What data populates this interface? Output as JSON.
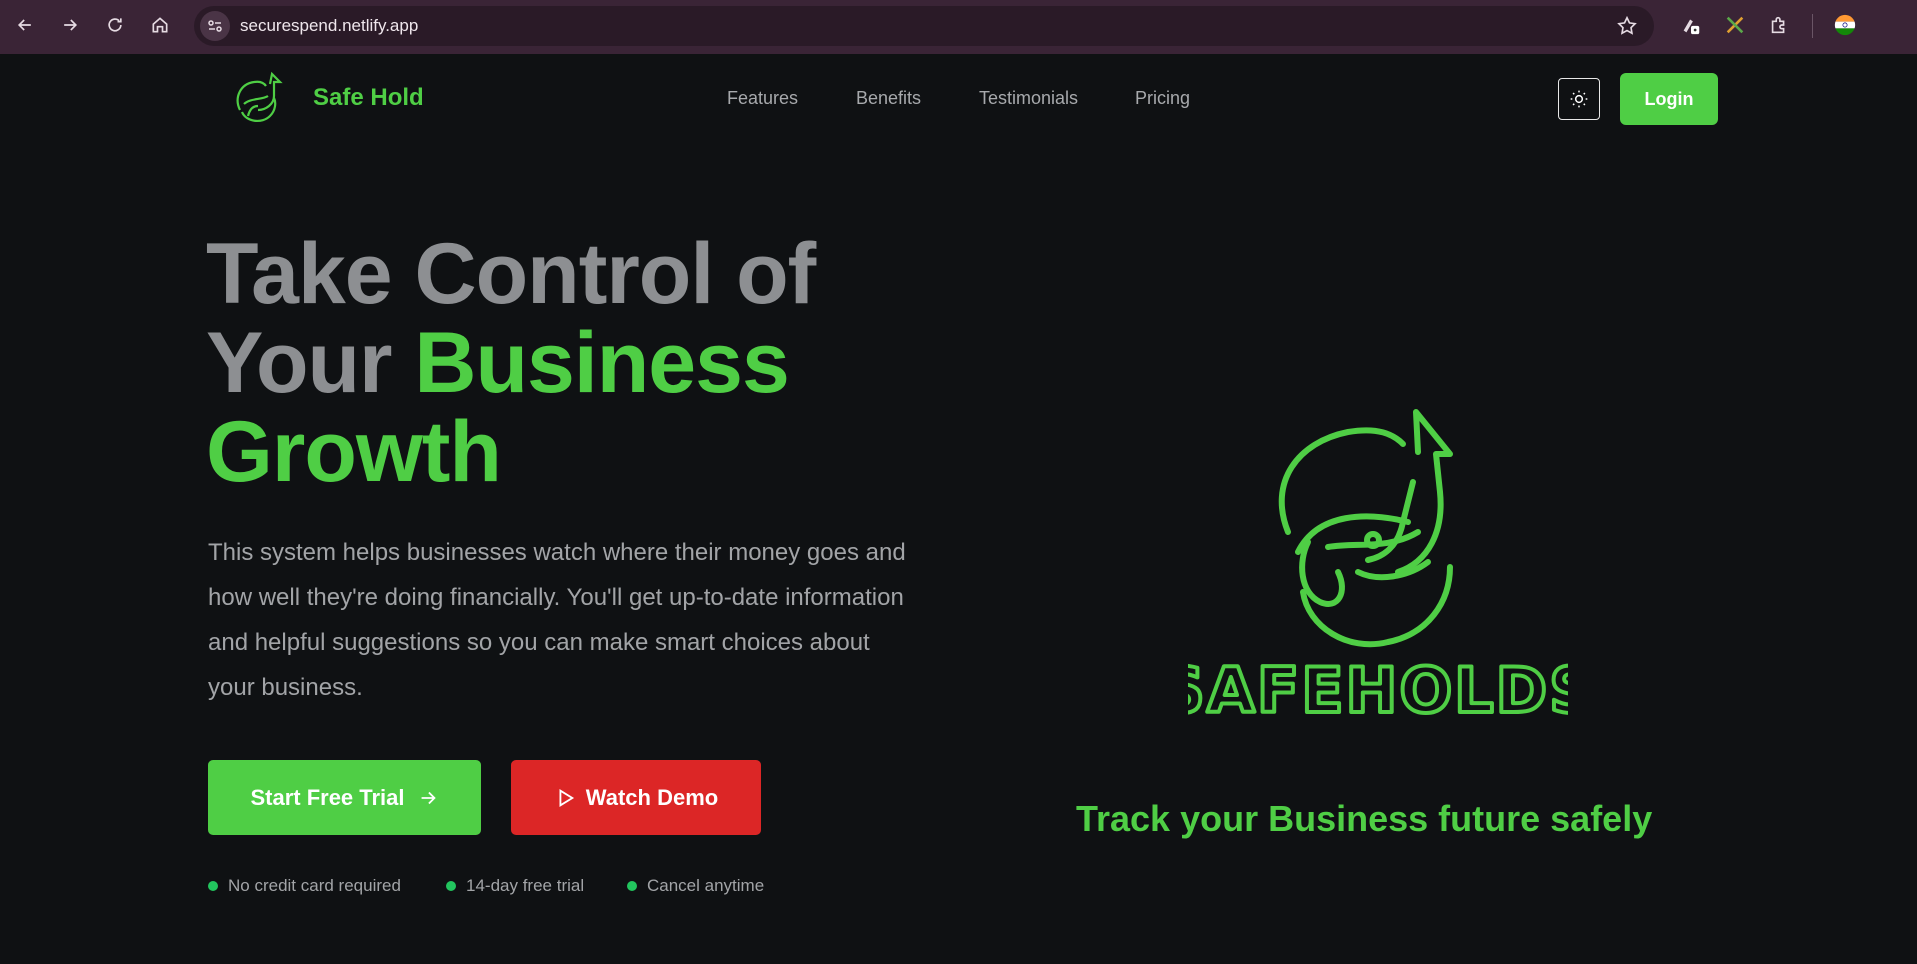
{
  "browser": {
    "url": "securespend.netlify.app",
    "icons": [
      "back-icon",
      "forward-icon",
      "reload-icon",
      "home-icon",
      "site-info-icon",
      "bookmark-star-icon",
      "extension-icon",
      "puzzle-icon",
      "profile-avatar"
    ]
  },
  "header": {
    "brand_name": "Safe Hold",
    "nav": [
      "Features",
      "Benefits",
      "Testimonials",
      "Pricing"
    ],
    "login_label": "Login"
  },
  "hero": {
    "title_line1": "Take Control of",
    "title_line2_plain": "Your ",
    "title_line2_accent": "Business",
    "title_line3_accent": "Growth",
    "description": "This system helps businesses watch where their money goes and how well they're doing financially. You'll get up-to-date information and helpful suggestions so you can make smart choices about your business.",
    "primary_cta": "Start Free Trial",
    "secondary_cta": "Watch Demo",
    "perks": [
      "No credit card required",
      "14-day free trial",
      "Cancel anytime"
    ]
  },
  "showcase": {
    "logo_text": "SAFEHOLDS",
    "tagline": "Track your Business future safely"
  },
  "colors": {
    "accent": "#4fce45",
    "danger": "#dc2626",
    "background": "#0f1113",
    "chrome": "#3a2436"
  }
}
